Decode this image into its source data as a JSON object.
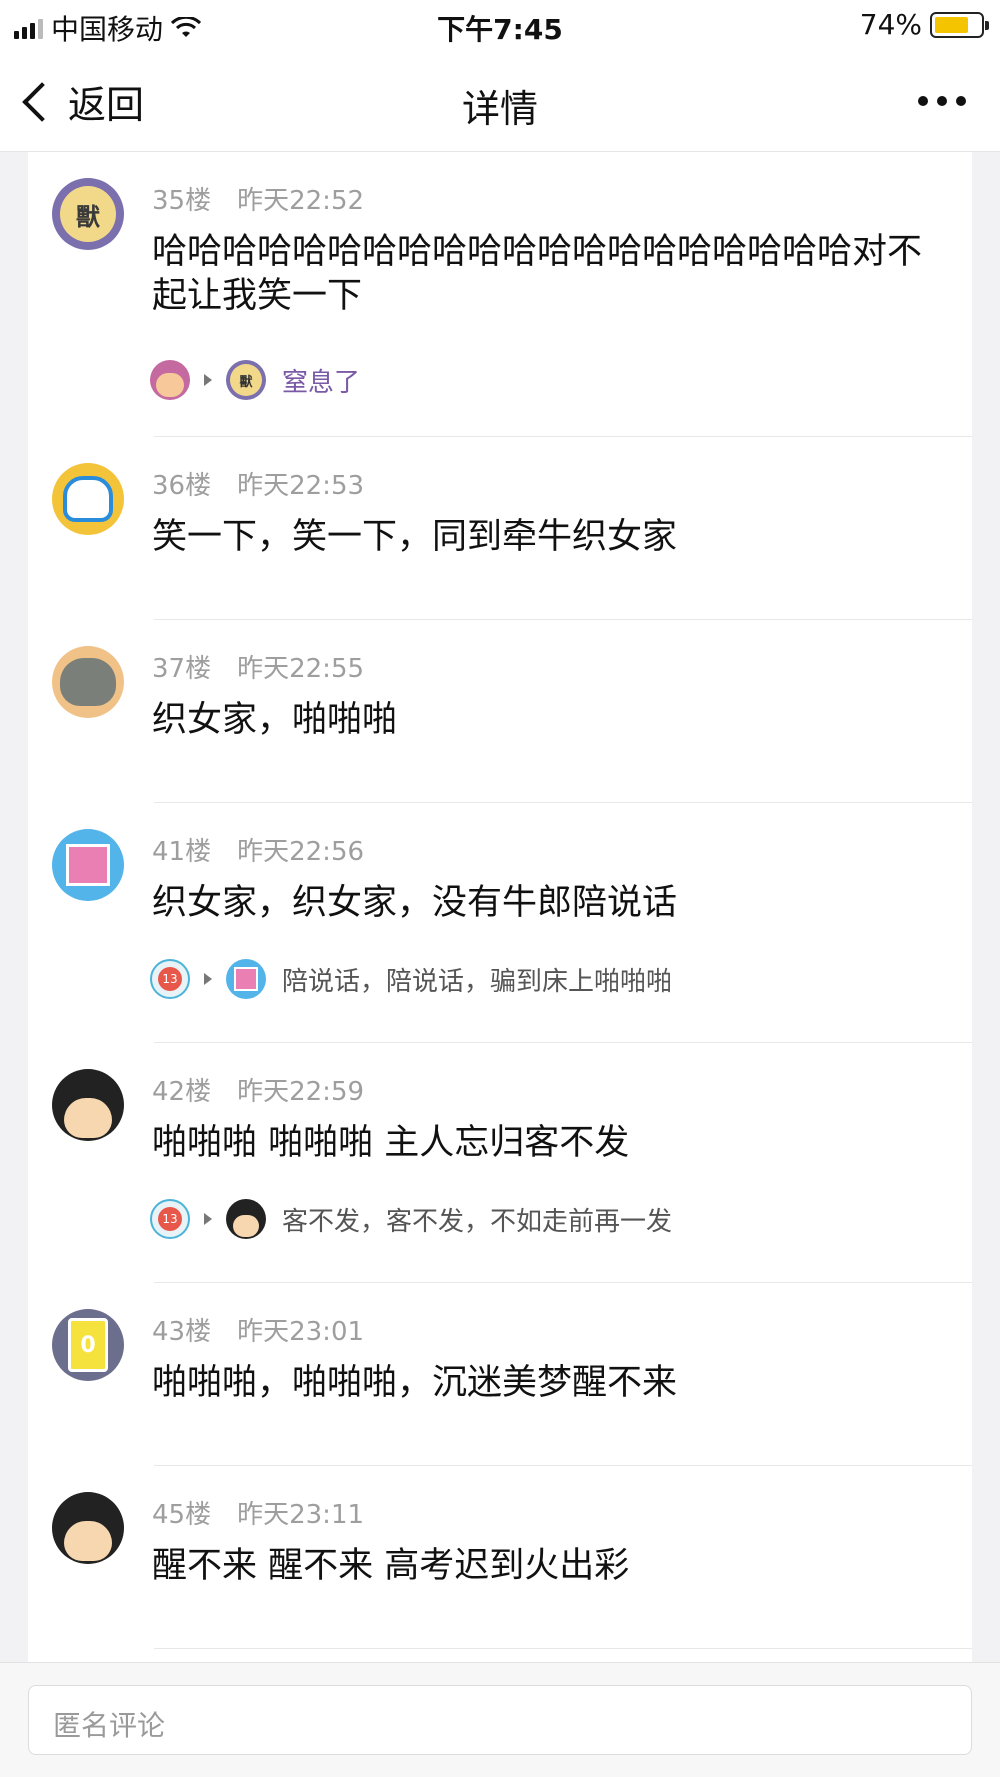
{
  "status_bar": {
    "carrier": "中国移动",
    "time": "下午7:45",
    "battery_text": "74%",
    "battery_level": 0.74,
    "wifi_icon": "wifi-icon"
  },
  "nav": {
    "back_label": "返回",
    "title": "详情"
  },
  "comments": [
    {
      "floor": "35楼",
      "time": "昨天22:52",
      "text": "哈哈哈哈哈哈哈哈哈哈哈哈哈哈哈哈哈哈哈哈对不起让我笑一下",
      "avatar_char": "獸",
      "reply": {
        "text": "窒息了"
      }
    },
    {
      "floor": "36楼",
      "time": "昨天22:53",
      "text": "笑一下，笑一下，同到牵牛织女家"
    },
    {
      "floor": "37楼",
      "time": "昨天22:55",
      "text": "织女家，啪啪啪"
    },
    {
      "floor": "41楼",
      "time": "昨天22:56",
      "text": "织女家，织女家，没有牛郎陪说话",
      "reply": {
        "text": "陪说话，陪说话，骗到床上啪啪啪",
        "badge": "13"
      }
    },
    {
      "floor": "42楼",
      "time": "昨天22:59",
      "text": "啪啪啪 啪啪啪 主人忘归客不发",
      "reply": {
        "text": "客不发，客不发，不如走前再一发",
        "badge": "13"
      }
    },
    {
      "floor": "43楼",
      "time": "昨天23:01",
      "text": "啪啪啪，啪啪啪，沉迷美梦醒不来",
      "avatar_char": "0"
    },
    {
      "floor": "45楼",
      "time": "昨天23:11",
      "text": "醒不来 醒不来 高考迟到火出彩"
    }
  ],
  "input": {
    "placeholder": "匿名评论"
  }
}
